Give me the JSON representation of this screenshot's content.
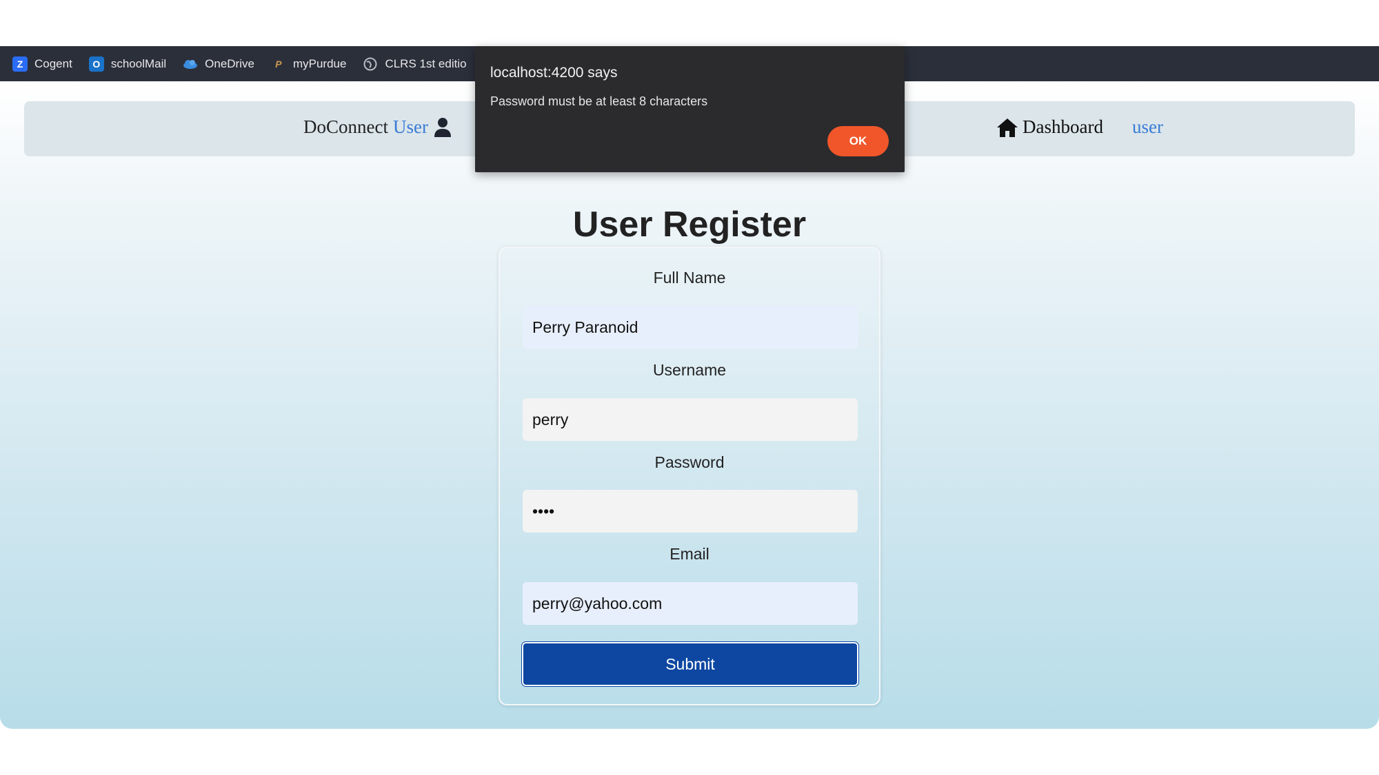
{
  "bookmarks": [
    {
      "label": "Cogent",
      "icon": "z-logo-icon"
    },
    {
      "label": "schoolMail",
      "icon": "outlook-mail-icon"
    },
    {
      "label": "OneDrive",
      "icon": "cloud-icon"
    },
    {
      "label": "myPurdue",
      "icon": "purdue-logo-icon"
    },
    {
      "label": "CLRS 1st editio",
      "icon": "globe-icon"
    }
  ],
  "navbar": {
    "brand": "DoConnect",
    "brand_accent": "User",
    "dashboard_label": "Dashboard",
    "user_link": "user"
  },
  "page": {
    "title": "User Register"
  },
  "form": {
    "fields": [
      {
        "label": "Full Name",
        "value": "Perry Paranoid"
      },
      {
        "label": "Username",
        "value": "perry"
      },
      {
        "label": "Password",
        "value": "••••"
      },
      {
        "label": "Email",
        "value": "perry@yahoo.com"
      }
    ],
    "submit_label": "Submit"
  },
  "alert": {
    "title": "localhost:4200 says",
    "message": "Password must be at least 8 characters",
    "ok_label": "OK"
  },
  "colors": {
    "accent": "#3a7bd5",
    "submit": "#0d47a1",
    "ok_button": "#f0562a",
    "bookmarks_bg": "#2b2f3a",
    "alert_bg": "#2b2b2d"
  }
}
